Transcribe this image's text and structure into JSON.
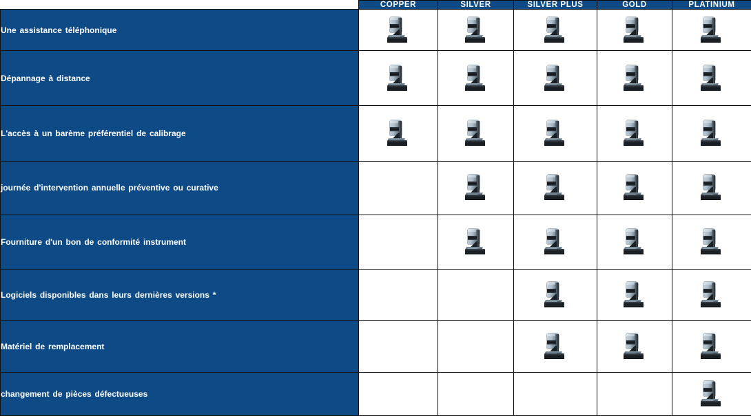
{
  "table": {
    "corner_label": "",
    "tiers": [
      {
        "id": "copper",
        "label": "COPPER"
      },
      {
        "id": "silver",
        "label": "SILVER"
      },
      {
        "id": "silver-plus",
        "label": "SILVER PLUS"
      },
      {
        "id": "gold",
        "label": "GOLD"
      },
      {
        "id": "platinium",
        "label": "PLATINIUM"
      }
    ],
    "rows": [
      {
        "feature": "Une assistance  téléphonique",
        "included": [
          true,
          true,
          true,
          true,
          true
        ]
      },
      {
        "feature": "Dépannage  à distance",
        "included": [
          true,
          true,
          true,
          true,
          true
        ]
      },
      {
        "feature": "L'accès  à un barème préférentiel de calibrage",
        "included": [
          true,
          true,
          true,
          true,
          true
        ]
      },
      {
        "feature": "journée d'intervention annuelle  préventive ou curative",
        "included": [
          false,
          true,
          true,
          true,
          true
        ]
      },
      {
        "feature": "Fourniture d'un bon de conformité instrument",
        "included": [
          false,
          true,
          true,
          true,
          true
        ]
      },
      {
        "feature": "Logiciels  disponibles  dans leurs dernières versions *",
        "included": [
          false,
          false,
          true,
          true,
          true
        ]
      },
      {
        "feature": "Matériel de remplacement",
        "included": [
          false,
          false,
          true,
          true,
          true
        ]
      },
      {
        "feature": "changement  de pièces défectueuses",
        "included": [
          false,
          false,
          false,
          false,
          true
        ]
      }
    ],
    "icon_name": "measuring-instrument-icon",
    "colors": {
      "header_blue": "#0d4a86",
      "feature_blue": "#0d4a86",
      "cell_white": "#ffffff",
      "border_black": "#0a0a0a",
      "header_text": "#ffffff"
    }
  }
}
